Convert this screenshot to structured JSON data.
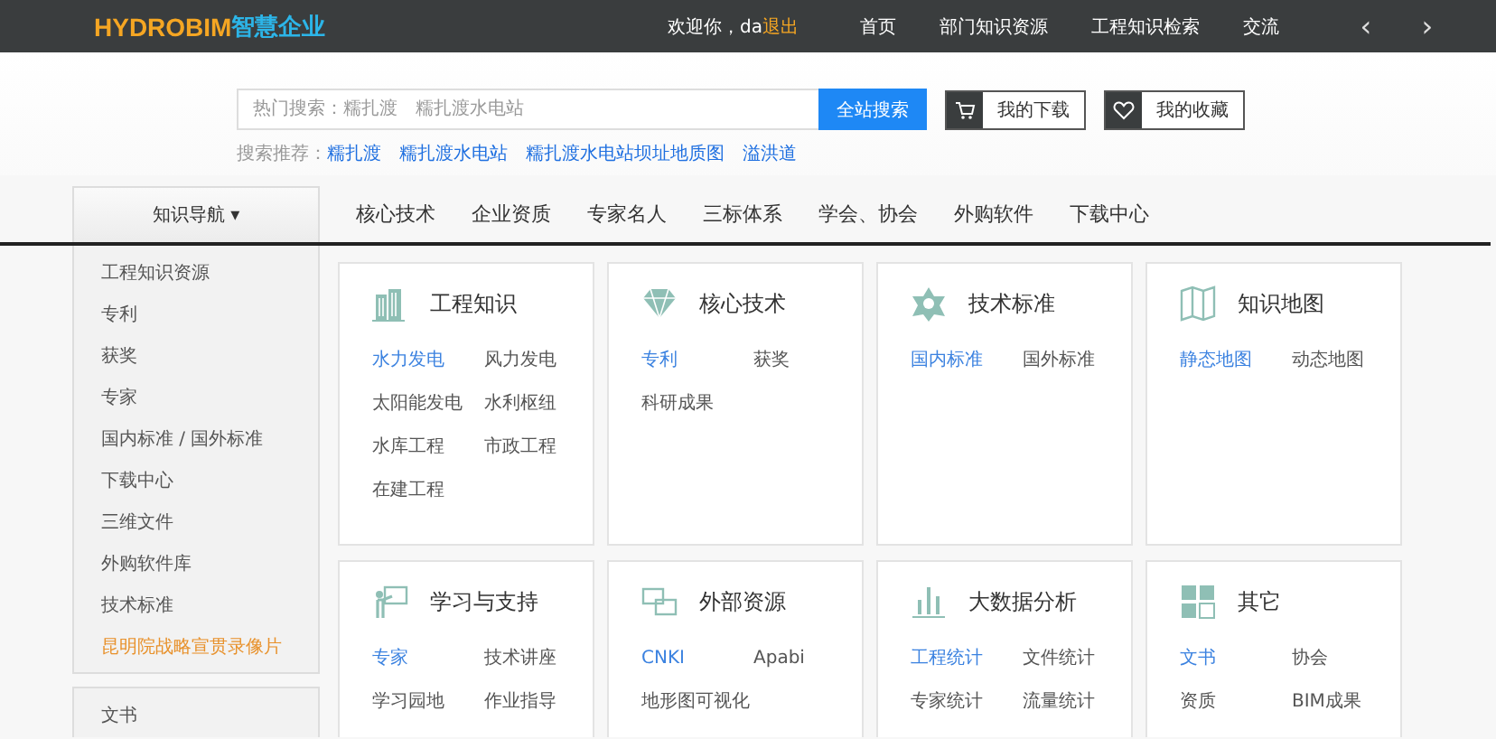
{
  "header": {
    "logo_en": "HYDROBIM",
    "logo_cn": "智慧企业",
    "welcome": "欢迎你，da",
    "logout": "退出",
    "nav": [
      "首页",
      "部门知识资源",
      "工程知识检索",
      "交流"
    ],
    "prev": "‹",
    "next": "›"
  },
  "search": {
    "placeholder": "热门搜索：糯扎渡　糯扎渡水电站",
    "button": "全站搜索",
    "shortcuts": [
      {
        "label": "我的下载",
        "kind": "cart"
      },
      {
        "label": "我的收藏",
        "kind": "heart"
      }
    ],
    "recommend_label": "搜索推荐：",
    "recommend": [
      "糯扎渡",
      "糯扎渡水电站",
      "糯扎渡水电站坝址地质图",
      "溢洪道"
    ]
  },
  "nav_toggle": "知识导航 ▾",
  "tabs": [
    "核心技术",
    "企业资质",
    "专家名人",
    "三标体系",
    "学会、协会",
    "外购软件",
    "下载中心"
  ],
  "sidebar": {
    "items": [
      {
        "label": "工程知识资源",
        "selected": false
      },
      {
        "label": "专利",
        "selected": false
      },
      {
        "label": "获奖",
        "selected": false
      },
      {
        "label": "专家",
        "selected": false
      },
      {
        "label": "国内标准 / 国外标准",
        "selected": false
      },
      {
        "label": "下载中心",
        "selected": false
      },
      {
        "label": "三维文件",
        "selected": false
      },
      {
        "label": "外购软件库",
        "selected": false
      },
      {
        "label": "技术标准",
        "selected": false
      },
      {
        "label": "昆明院战略宣贯录像片",
        "selected": true
      }
    ],
    "items_2": [
      {
        "label": "文书",
        "selected": false
      }
    ]
  },
  "cards": [
    {
      "title": "工程知识",
      "kind": "building",
      "links": [
        {
          "label": "水力发电",
          "active": true
        },
        {
          "label": "风力发电",
          "active": false
        },
        {
          "label": "太阳能发电",
          "active": false
        },
        {
          "label": "水利枢纽",
          "active": false
        },
        {
          "label": "水库工程",
          "active": false
        },
        {
          "label": "市政工程",
          "active": false
        },
        {
          "label": "在建工程",
          "active": false
        }
      ]
    },
    {
      "title": "核心技术",
      "kind": "diamond",
      "links": [
        {
          "label": "专利",
          "active": true
        },
        {
          "label": "获奖",
          "active": false
        },
        {
          "label": "科研成果",
          "active": false
        }
      ]
    },
    {
      "title": "技术标准",
      "kind": "star",
      "links": [
        {
          "label": "国内标准",
          "active": true
        },
        {
          "label": "国外标准",
          "active": false
        }
      ]
    },
    {
      "title": "知识地图",
      "kind": "map",
      "links": [
        {
          "label": "静态地图",
          "active": true
        },
        {
          "label": "动态地图",
          "active": false
        }
      ]
    },
    {
      "title": "学习与支持",
      "kind": "teacher",
      "links": [
        {
          "label": "专家",
          "active": true
        },
        {
          "label": "技术讲座",
          "active": false
        },
        {
          "label": "学习园地",
          "active": false
        },
        {
          "label": "作业指导",
          "active": false
        }
      ]
    },
    {
      "title": "外部资源",
      "kind": "link",
      "links": [
        {
          "label": "CNKI",
          "active": true
        },
        {
          "label": "Apabi",
          "active": false
        },
        {
          "label": "地形图可视化",
          "active": false
        }
      ]
    },
    {
      "title": "大数据分析",
      "kind": "chart",
      "links": [
        {
          "label": "工程统计",
          "active": true
        },
        {
          "label": "文件统计",
          "active": false
        },
        {
          "label": "专家统计",
          "active": false
        },
        {
          "label": "流量统计",
          "active": false
        }
      ]
    },
    {
      "title": "其它",
      "kind": "grid",
      "links": [
        {
          "label": "文书",
          "active": true
        },
        {
          "label": "协会",
          "active": false
        },
        {
          "label": "资质",
          "active": false
        },
        {
          "label": "BIM成果",
          "active": false
        }
      ]
    }
  ]
}
